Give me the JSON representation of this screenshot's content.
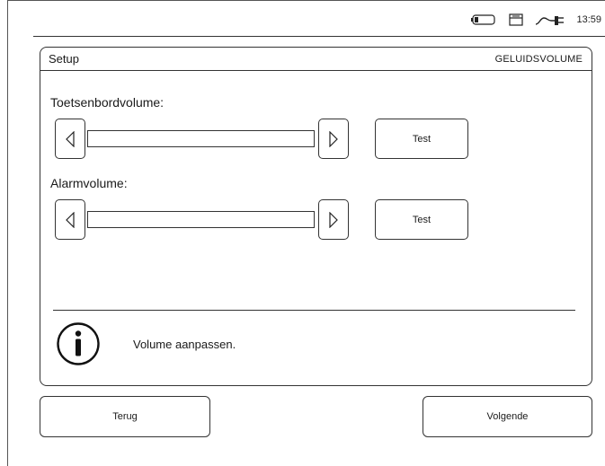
{
  "statusbar": {
    "time": "13:59",
    "icons": [
      "battery-icon",
      "printer-icon",
      "power-plug-icon"
    ]
  },
  "header": {
    "title": "Setup",
    "subtitle": "GELUIDSVOLUME"
  },
  "volumes": [
    {
      "label": "Toetsenbordvolume:",
      "test_label": "Test",
      "level": 0
    },
    {
      "label": "Alarmvolume:",
      "test_label": "Test",
      "level": 0
    }
  ],
  "info": {
    "icon": "info-icon",
    "message": "Volume aanpassen."
  },
  "footer": {
    "back_label": "Terug",
    "next_label": "Volgende"
  }
}
